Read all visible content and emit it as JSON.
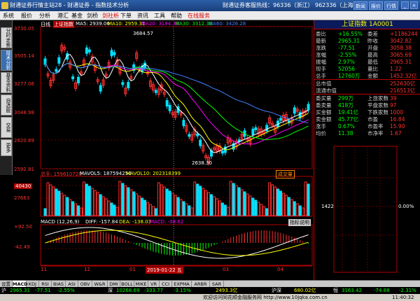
{
  "titlebar": {
    "title": "财通证券行情主站28 - 财通证券 - 指数技术分析",
    "hotline": "财通证券客服热线：96336（浙江） 962336（上海）",
    "b1": "新闻",
    "b2": "报价",
    "b3": "行情"
  },
  "menu": [
    "系统",
    "报价",
    "分析",
    "港汇",
    "基金",
    "剑桥",
    "剑社析",
    "下单",
    "资讯",
    "工具",
    "帮助",
    "在线服务"
  ],
  "left_tabs": [
    "分时走势",
    "技术分析",
    "基本资料",
    "自选股",
    "交易",
    "更多"
  ],
  "main": {
    "ma_line": {
      "label": "日线",
      "l1": "上证指数",
      "ma5": "MA5: 2939.06",
      "ma10": "MA10: 2959.31",
      "ma20": "MA20: 3184.39",
      "ma30": "MA30: 3312.38",
      "ma60": "MA60: 3426.28"
    },
    "price_axis": [
      "3730.05",
      "3505.14",
      "3277.06",
      "3048.98",
      "2820.89",
      "2592.81"
    ],
    "high_mark": "3684.57",
    "low_mark": "2638.30",
    "vol_line": {
      "t": "总手: 159610720",
      "v5": "MAVOL5: 187594250",
      "v10": "MAVOL10: 202318399",
      "btn": "成交量"
    },
    "vol_axis": [
      "40430",
      "27663"
    ],
    "macd_line": {
      "t": "MACD (12,26,9)",
      "diff": "DIFF: -157.84",
      "dea": "DEA: -138.03",
      "macd": "MACD: -39.62",
      "btn": "指标说明"
    },
    "macd_axis": [
      "+92.50",
      "-42.49"
    ],
    "x_axis": [
      "11",
      "12",
      "01",
      "02",
      "03",
      "04"
    ],
    "date_mark": "2019-01-22 五"
  },
  "rpanel": {
    "title": "上证指数 1A0001",
    "rows": [
      {
        "a": "委比",
        "b": "+16.55%",
        "c": "委差",
        "d": "+1186244"
      },
      {
        "a": "最新",
        "b": "2965.31",
        "c": "昨收",
        "d": "3042.82"
      },
      {
        "a": "涨跌",
        "b": "-77.51",
        "c": "开盘",
        "d": "3058.38"
      },
      {
        "a": "涨幅",
        "b": "-2.55%",
        "c": "最高",
        "d": "3065.69"
      },
      {
        "a": "振幅",
        "b": "2.97%",
        "c": "最低",
        "d": "2965.31"
      },
      {
        "a": "现手",
        "b": "52056",
        "c": "量比",
        "d": "1.22"
      },
      {
        "a": "总手",
        "b": "12760万",
        "c": "金额",
        "d": "1452.32亿"
      },
      {
        "a": "总市值",
        "b": "",
        "c": "",
        "d": "252630亿"
      },
      {
        "a": "流通市值",
        "b": "",
        "c": "",
        "d": "216513亿"
      },
      {
        "a": "委买量",
        "b": "299万",
        "c": "上涨家数",
        "d": "39"
      },
      {
        "a": "委卖量",
        "b": "418万",
        "c": "平盘家数",
        "d": "97"
      },
      {
        "a": "买金额",
        "b": "19.41亿",
        "c": "下跌家数",
        "d": "1000"
      },
      {
        "a": "卖金额",
        "b": "45.77亿",
        "c": "市盈",
        "d": "16.84"
      },
      {
        "a": "涨手",
        "b": "0.67%",
        "c": "市盈率",
        "d": "15.90"
      },
      {
        "a": "均价",
        "b": "11.38",
        "c": "市净率",
        "d": "1.67"
      }
    ],
    "depth_center": "1422",
    "depth_pct": "0.00%"
  },
  "bottom_tabs": [
    "设置",
    "MACD",
    "KDJ",
    "RSI",
    "BIAS",
    "ASI",
    "OBV",
    "W&R",
    "DMI",
    "BOLL",
    "MIKE",
    "VR",
    "CCI",
    "EXPMA",
    "ARBR",
    "SAR"
  ],
  "status": {
    "a": "沪",
    "a1": "2965.31",
    "a2": "-77.51",
    "a3": "-2.55%",
    "b": "深",
    "b1": "10268.69",
    "b2": "-333.77",
    "b3": "-3.15%",
    "c": "2493.3亿",
    "d": "沪深",
    "d1": "680.02亿",
    "e": "恒",
    "e1": "3163.42",
    "e2": "-74.88",
    "e3": "-2.31%"
  },
  "footer": {
    "msg": "欢迎访问同花顺金融服务网  http://www.10jqka.com.cn",
    "time": "11:40:32"
  },
  "colors": {
    "up": "#ff3030",
    "down": "#00e0ff",
    "ma5": "#ffffff",
    "ma10": "#ffff00",
    "ma20": "#ff00ff",
    "ma30": "#00ff00",
    "ma60": "#4080ff"
  }
}
